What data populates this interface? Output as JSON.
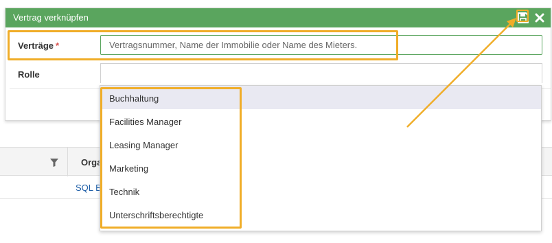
{
  "dialog": {
    "title": "Vertrag verknüpfen",
    "save_icon": "save-icon",
    "close_icon": "close-icon",
    "accent_color": "#5aa55e"
  },
  "form": {
    "contracts_label": "Verträge",
    "required_marker": "*",
    "contracts_value": "",
    "contracts_placeholder": "Vertragsnummer, Name der Immobilie oder Name des Mieters.",
    "role_label": "Rolle",
    "role_value": ""
  },
  "role_options": [
    "Buchhaltung",
    "Facilities Manager",
    "Leasing Manager",
    "Marketing",
    "Technik",
    "Unterschriftsberechtigte"
  ],
  "highlighted_option": "Buchhaltung",
  "background_grid": {
    "column_title": "Orga",
    "filter_icon": "filter-icon",
    "cell_text": "SQL B"
  },
  "annotation_color": "#f0ad28"
}
